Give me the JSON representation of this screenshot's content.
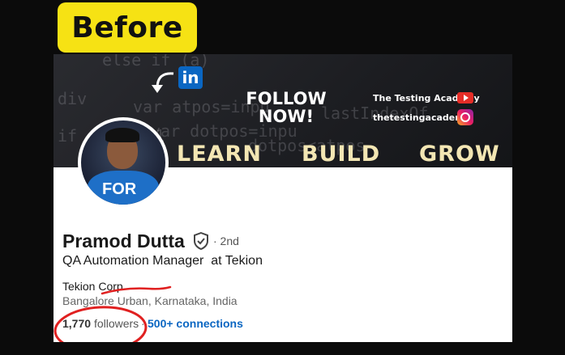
{
  "badge": {
    "label": "Before"
  },
  "banner": {
    "code_lines": [
      "else if (a)",
      "var atpos=inpu",
      "div",
      "var dotpos=inpu",
      "dotpos<atpos",
      "if (atpos<1",
      "lastIndexOf"
    ],
    "follow_now": "FOLLOW\nNOW!",
    "brand_youtube": "The Testing Academy",
    "brand_instagram": "thetestingacademy",
    "slogans": [
      "LEARN",
      "BUILD",
      "GROW"
    ],
    "linkedin_logo": "in"
  },
  "avatar": {
    "shirt_text": "FOR"
  },
  "profile": {
    "name": "Pramod Dutta",
    "degree": "· 2nd",
    "headline": "QA Automation Manager  at Tekion",
    "company": "Tekion Corp",
    "location": "Bangalore Urban, Karnataka, India",
    "followers_count": "1,770",
    "followers_label": "followers",
    "separator": "·",
    "connections": "500+ connections"
  },
  "colors": {
    "badge": "#f6e214",
    "annotation": "#e02020",
    "link": "#0a66c2"
  }
}
